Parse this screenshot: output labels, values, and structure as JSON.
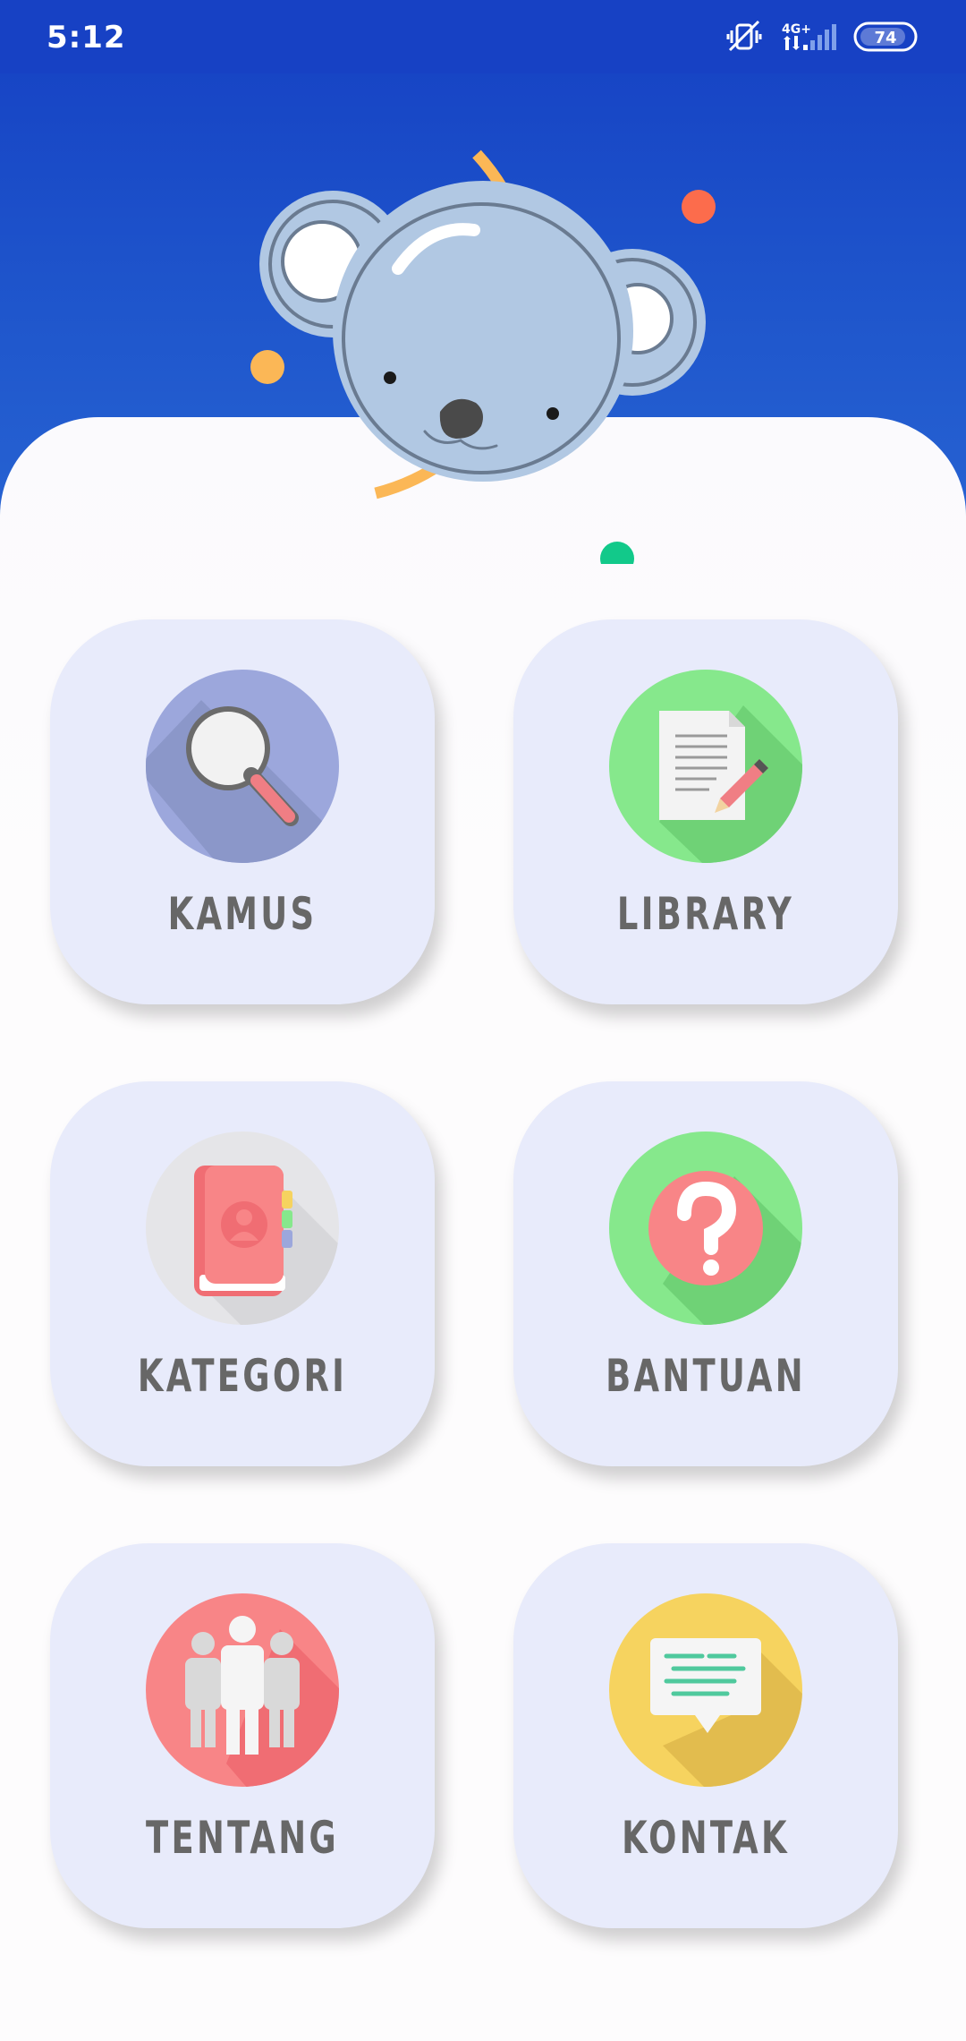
{
  "status_bar": {
    "time": "5:12",
    "network": "4G+",
    "battery": "74",
    "icons": [
      "vibrate-icon",
      "signal-icon",
      "battery-icon"
    ]
  },
  "menu": {
    "items": [
      {
        "label": "KAMUS",
        "icon": "search-icon",
        "color": "#9ca7dc"
      },
      {
        "label": "LIBRARY",
        "icon": "document-edit-icon",
        "color": "#86e88c"
      },
      {
        "label": "KATEGORI",
        "icon": "contact-book-icon",
        "color": "#e5e5e8"
      },
      {
        "label": "BANTUAN",
        "icon": "help-icon",
        "color": "#86e88c"
      },
      {
        "label": "TENTANG",
        "icon": "people-icon",
        "color": "#f88587"
      },
      {
        "label": "KONTAK",
        "icon": "chat-icon",
        "color": "#f6d35f"
      }
    ]
  },
  "colors": {
    "header_blue": "#1741c4",
    "tile_bg": "#e8ebfb",
    "label_gray": "#676767"
  }
}
